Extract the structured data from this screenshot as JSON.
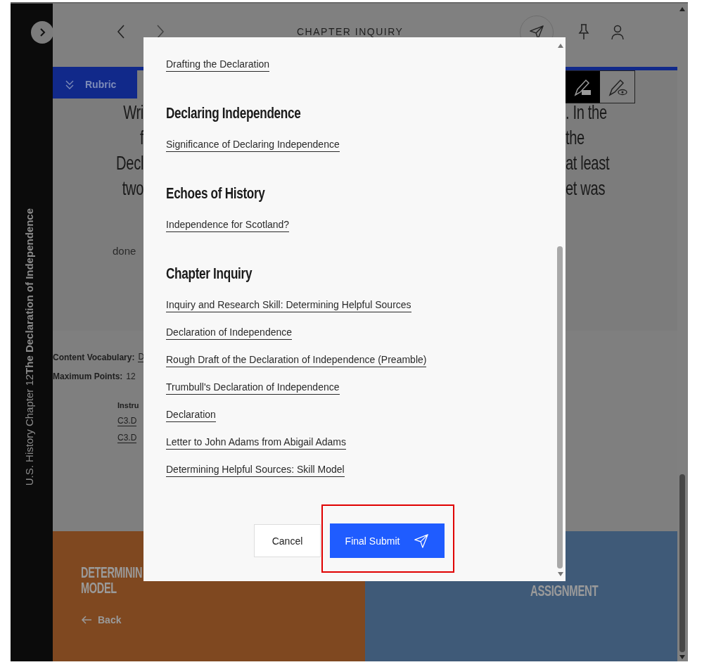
{
  "sidebar": {
    "book": "U.S. History Chapter 12",
    "title": "The Declaration of Independence"
  },
  "header": {
    "title": "CHAPTER INQUIRY"
  },
  "rubric_tab": {
    "label": "Rubric"
  },
  "tools": [
    {
      "kind": "highlight",
      "selected": true
    },
    {
      "kind": "review",
      "selected": false
    }
  ],
  "prompt": {
    "left_fragments": [
      "Wri",
      "f",
      "Decl",
      "two"
    ],
    "right_fragments": [
      ". In the",
      "the",
      "at least",
      "et was"
    ]
  },
  "note": "done",
  "details": [
    {
      "label": "Content Vocabulary:",
      "value": "D",
      "kind": "link"
    },
    {
      "label": "Maximum Points:",
      "value": "12",
      "kind": "text"
    }
  ],
  "instructions": {
    "heading": "Instru",
    "links": [
      "C3.D",
      "C3.D"
    ]
  },
  "footer": {
    "previous": {
      "title_lines": [
        "DETERMININ",
        "MODEL"
      ],
      "back": "Back"
    },
    "next": {
      "title": "ASSIGNMENT"
    }
  },
  "dialog": {
    "sections": [
      {
        "links": [
          "Drafting the Declaration"
        ]
      },
      {
        "heading": "Declaring Independence",
        "links": [
          "Significance of Declaring Independence"
        ]
      },
      {
        "heading": "Echoes of History",
        "links": [
          "Independence for Scotland?"
        ]
      },
      {
        "heading": "Chapter Inquiry",
        "links": [
          "Inquiry and Research Skill: Determining Helpful Sources",
          "Declaration of Independence",
          "Rough Draft of the Declaration of Independence (Preamble)",
          "Trumbull's Declaration of Independence",
          "Declaration",
          "Letter to John Adams from Abigail Adams",
          "Determining Helpful Sources: Skill Model"
        ]
      }
    ],
    "cancel": "Cancel",
    "submit": "Final Submit"
  }
}
